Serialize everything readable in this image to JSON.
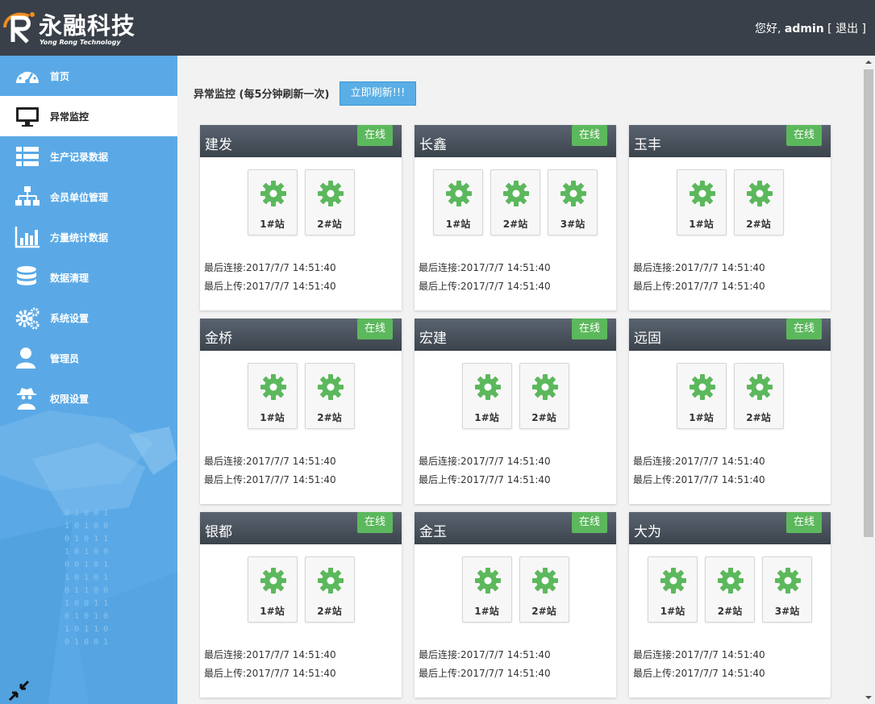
{
  "brand": {
    "name": "永融科技",
    "subtitle": "Yong Rong Technology",
    "accent": "#f08c1e"
  },
  "user": {
    "greeting": "您好,",
    "name": "admin",
    "logout": "[ 退出 ]"
  },
  "sidebar": {
    "items": [
      {
        "label": "首页",
        "icon": "dashboard-icon"
      },
      {
        "label": "异常监控",
        "icon": "monitor-icon"
      },
      {
        "label": "生产记录数据",
        "icon": "list-icon"
      },
      {
        "label": "会员单位管理",
        "icon": "org-chart-icon"
      },
      {
        "label": "方量统计数据",
        "icon": "bar-chart-icon"
      },
      {
        "label": "数据清理",
        "icon": "database-icon"
      },
      {
        "label": "系统设置",
        "icon": "gears-icon"
      },
      {
        "label": "管理员",
        "icon": "user-icon"
      },
      {
        "label": "权限设置",
        "icon": "spy-icon"
      }
    ],
    "active_index": 1
  },
  "monitor": {
    "title": "异常监控 (每5分钟刷新一次)",
    "refresh_label": "立即刷新!!!",
    "status_color": "#5cb85c",
    "cards": [
      {
        "name": "建发",
        "status": "在线",
        "stations": [
          "1#站",
          "2#站"
        ],
        "last_connect": "最后连接:2017/7/7 14:51:40",
        "last_upload": "最后上传:2017/7/7 14:51:40"
      },
      {
        "name": "长鑫",
        "status": "在线",
        "stations": [
          "1#站",
          "2#站",
          "3#站"
        ],
        "last_connect": "最后连接:2017/7/7 14:51:40",
        "last_upload": "最后上传:2017/7/7 14:51:40"
      },
      {
        "name": "玉丰",
        "status": "在线",
        "stations": [
          "1#站",
          "2#站"
        ],
        "last_connect": "最后连接:2017/7/7 14:51:40",
        "last_upload": "最后上传:2017/7/7 14:51:40"
      },
      {
        "name": "金桥",
        "status": "在线",
        "stations": [
          "1#站",
          "2#站"
        ],
        "last_connect": "最后连接:2017/7/7 14:51:40",
        "last_upload": "最后上传:2017/7/7 14:51:40"
      },
      {
        "name": "宏建",
        "status": "在线",
        "stations": [
          "1#站",
          "2#站"
        ],
        "last_connect": "最后连接:2017/7/7 14:51:40",
        "last_upload": "最后上传:2017/7/7 14:51:40"
      },
      {
        "name": "远固",
        "status": "在线",
        "stations": [
          "1#站",
          "2#站"
        ],
        "last_connect": "最后连接:2017/7/7 14:51:40",
        "last_upload": "最后上传:2017/7/7 14:51:40"
      },
      {
        "name": "银都",
        "status": "在线",
        "stations": [
          "1#站",
          "2#站"
        ],
        "last_connect": "最后连接:2017/7/7 14:51:40",
        "last_upload": "最后上传:2017/7/7 14:51:40"
      },
      {
        "name": "金玉",
        "status": "在线",
        "stations": [
          "1#站",
          "2#站"
        ],
        "last_connect": "最后连接:2017/7/7 14:51:40",
        "last_upload": "最后上传:2017/7/7 14:51:40"
      },
      {
        "name": "大为",
        "status": "在线",
        "stations": [
          "1#站",
          "2#站",
          "3#站"
        ],
        "last_connect": "最后连接:2017/7/7 14:51:40",
        "last_upload": "最后上传:2017/7/7 14:51:40"
      }
    ]
  }
}
